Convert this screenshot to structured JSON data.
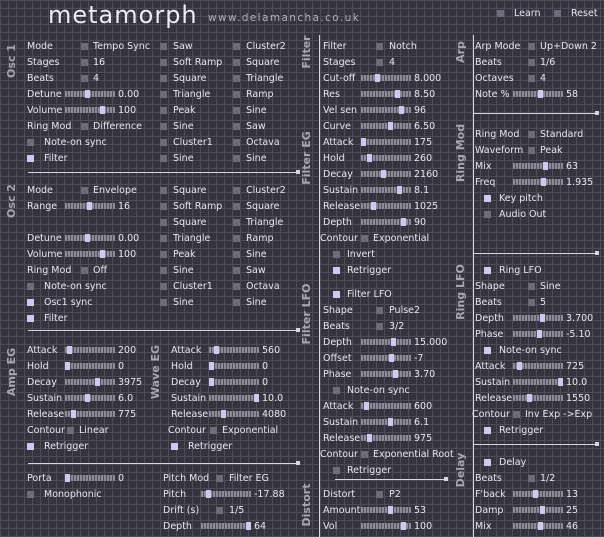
{
  "app": {
    "title": "metamorph",
    "url": "www.delamancha.co.uk",
    "learn": "Learn",
    "reset": "Reset"
  },
  "sections": {
    "osc1": "Osc 1",
    "osc2": "Osc 2",
    "ampeg": "Amp EG",
    "waveeg": "Wave EG",
    "filter": "Filter",
    "filtereg": "Filter EG",
    "filterlfo": "Filter LFO",
    "distort": "Distort",
    "arp": "Arp",
    "ringmod": "Ring Mod",
    "ringlfo": "Ring LFO",
    "delay": "Delay"
  },
  "osc1": {
    "mode_label": "Mode",
    "mode": "Tempo Sync",
    "stages_label": "Stages",
    "stages": "16",
    "beats_label": "Beats",
    "beats": "4",
    "detune_label": "Detune",
    "detune": "0.00",
    "volume_label": "Volume",
    "volume": "100",
    "ringmod_label": "Ring Mod",
    "ringmod": "Difference",
    "noteon": "Note-on sync",
    "filter": "Filter",
    "waves_a": [
      "Saw",
      "Soft Ramp",
      "Square",
      "Triangle",
      "Peak",
      "Sine",
      "Cluster1",
      "Sine"
    ],
    "waves_b": [
      "Cluster2",
      "Square",
      "Triangle",
      "Ramp",
      "Sine",
      "Saw",
      "Octava",
      "Sine"
    ]
  },
  "osc2": {
    "mode_label": "Mode",
    "mode": "Envelope",
    "range_label": "Range",
    "range": "16",
    "detune_label": "Detune",
    "detune": "0.00",
    "volume_label": "Volume",
    "volume": "100",
    "ringmod_label": "Ring Mod",
    "ringmod": "Off",
    "noteon": "Note-on sync",
    "osc1sync": "Osc1 sync",
    "filter": "Filter",
    "waves_a": [
      "Square",
      "Soft Ramp",
      "Square",
      "Triangle",
      "Peak",
      "Sine",
      "Cluster1",
      "Sine"
    ],
    "waves_b": [
      "Cluster2",
      "Square",
      "Triangle",
      "Ramp",
      "Sine",
      "Saw",
      "Octava",
      "Sine"
    ]
  },
  "ampeg": {
    "attack_label": "Attack",
    "attack": "200",
    "hold_label": "Hold",
    "hold": "0",
    "decay_label": "Decay",
    "decay": "3975",
    "sustain_label": "Sustain",
    "sustain": "6.0",
    "release_label": "Release",
    "release": "775",
    "contour_label": "Contour",
    "contour": "Linear",
    "retrigger": "Retrigger"
  },
  "waveeg": {
    "attack_label": "Attack",
    "attack": "560",
    "hold_label": "Hold",
    "hold": "0",
    "decay_label": "Decay",
    "decay": "0",
    "sustain_label": "Sustain",
    "sustain": "10.0",
    "release_label": "Release",
    "release": "4080",
    "contour_label": "Contour",
    "contour": "Exponential",
    "retrigger": "Retrigger"
  },
  "porta": {
    "porta_label": "Porta",
    "porta": "0",
    "monophonic": "Monophonic",
    "pitchmod_label": "Pitch Mod",
    "pitchmod": "Filter EG",
    "pitch_label": "Pitch",
    "pitch": "-17.88",
    "drift_label": "Drift (s)",
    "drift": "1/5",
    "depth_label": "Depth",
    "depth": "64"
  },
  "filter": {
    "filter_label": "Filter",
    "filter": "Notch",
    "stages_label": "Stages",
    "stages": "4",
    "cutoff_label": "Cut-off",
    "cutoff": "8.000",
    "res_label": "Res",
    "res": "8.50",
    "velsen_label": "Vel sen",
    "velsen": "96",
    "curve_label": "Curve",
    "curve": "6.50"
  },
  "filtereg": {
    "attack_label": "Attack",
    "attack": "175",
    "hold_label": "Hold",
    "hold": "260",
    "decay_label": "Decay",
    "decay": "2160",
    "sustain_label": "Sustain",
    "sustain": "8.1",
    "release_label": "Release",
    "release": "1025",
    "depth_label": "Depth",
    "depth": "90",
    "contour_label": "Contour",
    "contour": "Exponential",
    "invert": "Invert",
    "retrigger": "Retrigger"
  },
  "filterlfo": {
    "toggle": "Filter LFO",
    "shape_label": "Shape",
    "shape": "Pulse2",
    "beats_label": "Beats",
    "beats": "3/2",
    "depth_label": "Depth",
    "depth": "15.000",
    "offset_label": "Offset",
    "offset": "-7",
    "phase_label": "Phase",
    "phase": "3.70",
    "noteon": "Note-on sync",
    "attack_label": "Attack",
    "attack": "600",
    "sustain_label": "Sustain",
    "sustain": "6.1",
    "release_label": "Release",
    "release": "975",
    "contour_label": "Contour",
    "contour": "Exponential Root",
    "retrigger": "Retrigger"
  },
  "distort": {
    "distort_label": "Distort",
    "distort": "P2",
    "amount_label": "Amount",
    "amount": "53",
    "vol_label": "Vol",
    "vol": "100"
  },
  "arp": {
    "mode_label": "Arp Mode",
    "mode": "Up+Down 2",
    "beats_label": "Beats",
    "beats": "1/6",
    "octaves_label": "Octaves",
    "octaves": "4",
    "note_label": "Note %",
    "note": "58"
  },
  "ringmod": {
    "ringmod_label": "Ring Mod",
    "ringmod": "Standard",
    "waveform_label": "Waveform",
    "waveform": "Peak",
    "mix_label": "Mix",
    "mix": "63",
    "freq_label": "Freq",
    "freq": "1.935",
    "keypitch": "Key pitch",
    "audioout": "Audio Out"
  },
  "ringlfo": {
    "toggle": "Ring LFO",
    "shape_label": "Shape",
    "shape": "Sine",
    "beats_label": "Beats",
    "beats": "5",
    "depth_label": "Depth",
    "depth": "3.700",
    "phase_label": "Phase",
    "phase": "-5.10",
    "noteon": "Note-on sync",
    "attack_label": "Attack",
    "attack": "725",
    "sustain_label": "Sustain",
    "sustain": "10.0",
    "release_label": "Release",
    "release": "1550",
    "contour_label": "Contour",
    "contour": "Inv Exp ->Exp",
    "retrigger": "Retrigger"
  },
  "delay": {
    "toggle": "Delay",
    "beats_label": "Beats",
    "beats": "1/2",
    "fback_label": "F'back",
    "fback": "13",
    "damp_label": "Damp",
    "damp": "25",
    "mix_label": "Mix",
    "mix": "46"
  }
}
